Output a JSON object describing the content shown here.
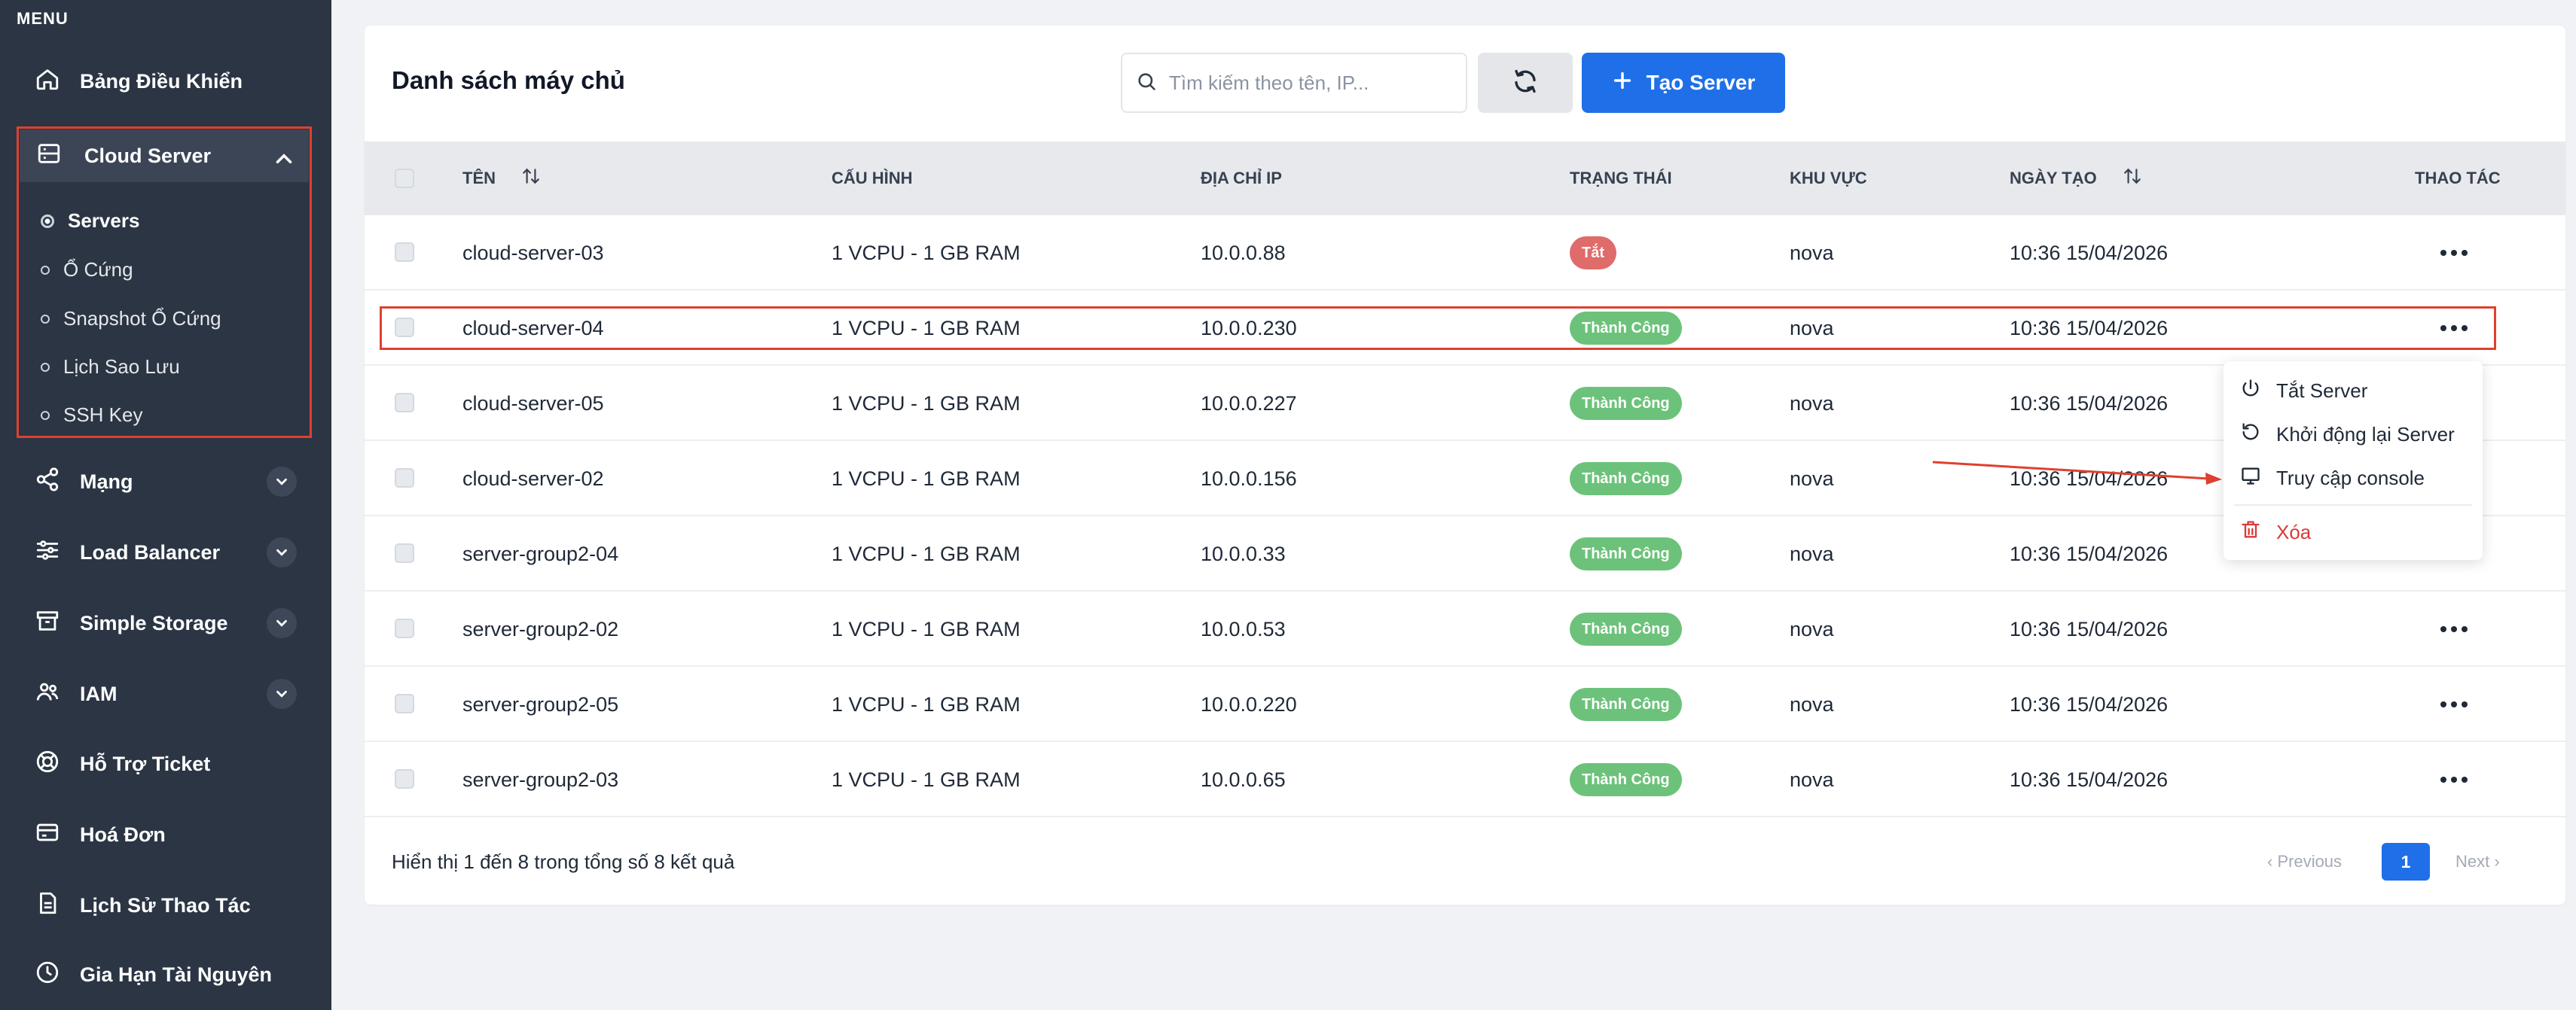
{
  "sidebar": {
    "menu_label": "MENU",
    "items": [
      {
        "label": "Bảng Điều Khiển",
        "icon": "home-icon"
      },
      {
        "label": "Cloud Server",
        "icon": "server-icon",
        "expanded": true
      },
      {
        "label": "Mạng",
        "icon": "share-icon"
      },
      {
        "label": "Load Balancer",
        "icon": "sliders-icon"
      },
      {
        "label": "Simple Storage",
        "icon": "archive-icon"
      },
      {
        "label": "IAM",
        "icon": "users-icon"
      },
      {
        "label": "Hỗ Trợ Ticket",
        "icon": "lifebuoy-icon"
      },
      {
        "label": "Hoá Đơn",
        "icon": "credit-card-icon"
      },
      {
        "label": "Lịch Sử Thao Tác",
        "icon": "document-icon"
      },
      {
        "label": "Gia Hạn Tài Nguyên",
        "icon": "clock-icon"
      }
    ],
    "cloud_server_sub": [
      {
        "label": "Servers",
        "active": true
      },
      {
        "label": "Ổ Cứng"
      },
      {
        "label": "Snapshot Ổ Cứng"
      },
      {
        "label": "Lịch Sao Lưu"
      },
      {
        "label": "SSH Key"
      }
    ]
  },
  "header": {
    "title": "Danh sách máy chủ",
    "search_placeholder": "Tìm kiếm theo tên, IP...",
    "create_label": "Tạo Server"
  },
  "table": {
    "columns": {
      "name": "TÊN",
      "config": "CẤU HÌNH",
      "ip": "ĐỊA CHỈ IP",
      "status": "TRẠNG THÁI",
      "region": "KHU VỰC",
      "created": "NGÀY TẠO",
      "actions": "THAO TÁC"
    },
    "rows": [
      {
        "name": "cloud-server-03",
        "config": "1 VCPU - 1 GB RAM",
        "ip": "10.0.0.88",
        "status": "Tắt",
        "status_type": "off",
        "region": "nova",
        "created": "10:36 15/04/2026",
        "has_action": true
      },
      {
        "name": "cloud-server-04",
        "config": "1 VCPU - 1 GB RAM",
        "ip": "10.0.0.230",
        "status": "Thành Công",
        "status_type": "ok",
        "region": "nova",
        "created": "10:36 15/04/2026",
        "has_action": true
      },
      {
        "name": "cloud-server-05",
        "config": "1 VCPU - 1 GB RAM",
        "ip": "10.0.0.227",
        "status": "Thành Công",
        "status_type": "ok",
        "region": "nova",
        "created": "10:36 15/04/2026",
        "has_action": false
      },
      {
        "name": "cloud-server-02",
        "config": "1 VCPU - 1 GB RAM",
        "ip": "10.0.0.156",
        "status": "Thành Công",
        "status_type": "ok",
        "region": "nova",
        "created": "10:36 15/04/2026",
        "has_action": false
      },
      {
        "name": "server-group2-04",
        "config": "1 VCPU - 1 GB RAM",
        "ip": "10.0.0.33",
        "status": "Thành Công",
        "status_type": "ok",
        "region": "nova",
        "created": "10:36 15/04/2026",
        "has_action": false
      },
      {
        "name": "server-group2-02",
        "config": "1 VCPU - 1 GB RAM",
        "ip": "10.0.0.53",
        "status": "Thành Công",
        "status_type": "ok",
        "region": "nova",
        "created": "10:36 15/04/2026",
        "has_action": true
      },
      {
        "name": "server-group2-05",
        "config": "1 VCPU - 1 GB RAM",
        "ip": "10.0.0.220",
        "status": "Thành Công",
        "status_type": "ok",
        "region": "nova",
        "created": "10:36 15/04/2026",
        "has_action": true
      },
      {
        "name": "server-group2-03",
        "config": "1 VCPU - 1 GB RAM",
        "ip": "10.0.0.65",
        "status": "Thành Công",
        "status_type": "ok",
        "region": "nova",
        "created": "10:36 15/04/2026",
        "has_action": true
      }
    ]
  },
  "footer": {
    "summary": "Hiển thị 1 đến 8 trong tổng số 8 kết quả",
    "prev_label": "Previous",
    "next_label": "Next",
    "current_page": "1"
  },
  "dropdown": {
    "items": [
      {
        "label": "Tắt Server",
        "icon": "power-icon"
      },
      {
        "label": "Khởi động lại Server",
        "icon": "restart-icon"
      },
      {
        "label": "Truy cập console",
        "icon": "monitor-icon"
      },
      {
        "label": "Xóa",
        "icon": "trash-icon",
        "danger": true
      }
    ]
  },
  "colors": {
    "sidebar_bg": "#2b3544",
    "primary": "#1f6fe8",
    "success": "#6cc27a",
    "danger": "#e06b6b",
    "annotation_red": "#e0402f"
  }
}
